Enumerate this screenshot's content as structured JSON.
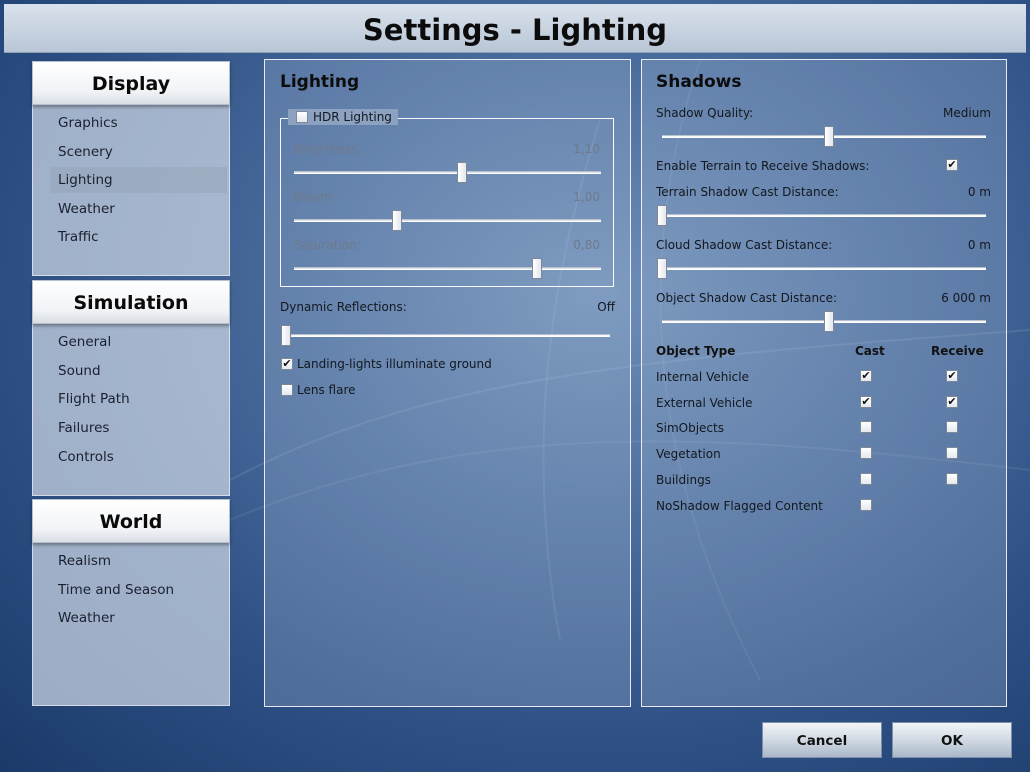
{
  "title": "Settings - Lighting",
  "nav": {
    "display": {
      "header": "Display",
      "items": [
        "Graphics",
        "Scenery",
        "Lighting",
        "Weather",
        "Traffic"
      ],
      "selected": "Lighting"
    },
    "simulation": {
      "header": "Simulation",
      "items": [
        "General",
        "Sound",
        "Flight Path",
        "Failures",
        "Controls"
      ]
    },
    "world": {
      "header": "World",
      "items": [
        "Realism",
        "Time and Season",
        "Weather"
      ]
    }
  },
  "lighting": {
    "title": "Lighting",
    "hdr": {
      "label": "HDR Lighting",
      "checked": false
    },
    "brightness": {
      "label": "Brightness:",
      "value": "1,10",
      "level": 0.55
    },
    "bloom": {
      "label": "Bloom:",
      "value": "1,00",
      "level": 0.33
    },
    "saturation": {
      "label": "Saturation:",
      "value": "0,80",
      "level": 0.8
    },
    "dynamic_reflections": {
      "label": "Dynamic Reflections:",
      "value": "Off",
      "level": 0.0
    },
    "landing_lights": {
      "label": "Landing-lights illuminate ground",
      "checked": true
    },
    "lens_flare": {
      "label": "Lens flare",
      "checked": false
    }
  },
  "shadows": {
    "title": "Shadows",
    "quality": {
      "label": "Shadow Quality:",
      "value": "Medium",
      "level": 0.5
    },
    "terrain_receive": {
      "label": "Enable Terrain to Receive Shadows:",
      "checked": true
    },
    "terrain_distance": {
      "label": "Terrain Shadow Cast Distance:",
      "value": "0 m",
      "level": 0.0
    },
    "cloud_distance": {
      "label": "Cloud Shadow Cast Distance:",
      "value": "0 m",
      "level": 0.0
    },
    "object_distance": {
      "label": "Object Shadow Cast Distance:",
      "value": "6 000 m",
      "level": 0.5
    },
    "table": {
      "headers": {
        "type": "Object Type",
        "cast": "Cast",
        "receive": "Receive"
      },
      "rows": [
        {
          "name": "Internal Vehicle",
          "cast": true,
          "receive": true
        },
        {
          "name": "External Vehicle",
          "cast": true,
          "receive": true
        },
        {
          "name": "SimObjects",
          "cast": false,
          "receive": false
        },
        {
          "name": "Vegetation",
          "cast": false,
          "receive": false
        },
        {
          "name": "Buildings",
          "cast": false,
          "receive": false
        },
        {
          "name": "NoShadow Flagged Content",
          "cast": false
        }
      ]
    }
  },
  "buttons": {
    "cancel": "Cancel",
    "ok": "OK"
  },
  "colors": {
    "title_bar": "#c8d3e0",
    "background": "#2f5186",
    "panel_border": "#ffffff"
  }
}
